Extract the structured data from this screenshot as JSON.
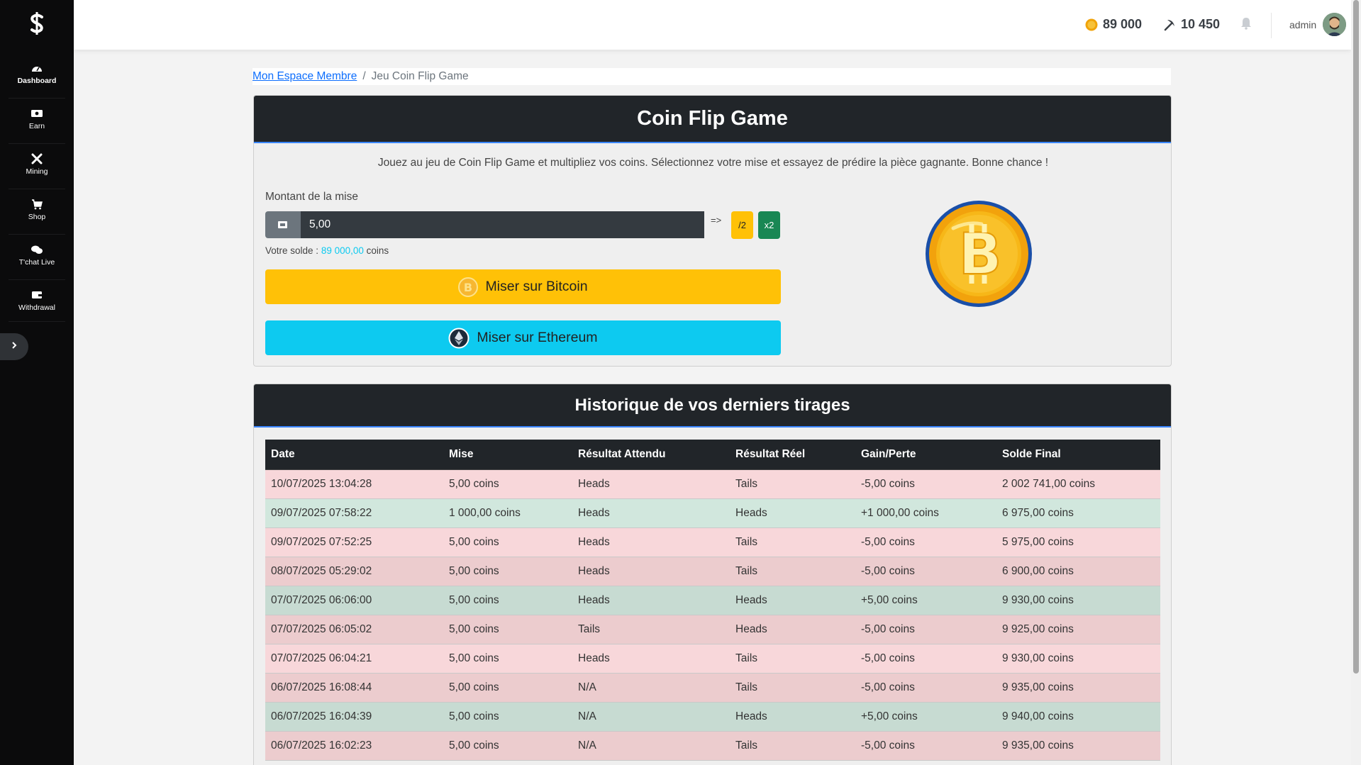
{
  "sidebar": {
    "items": [
      {
        "label": "Dashboard",
        "icon": "dashboard-icon"
      },
      {
        "label": "Earn",
        "icon": "money-icon"
      },
      {
        "label": "Mining",
        "icon": "tools-icon"
      },
      {
        "label": "Shop",
        "icon": "cart-icon"
      },
      {
        "label": "T'chat Live",
        "icon": "chat-icon"
      },
      {
        "label": "Withdrawal",
        "icon": "wallet-icon"
      }
    ]
  },
  "topbar": {
    "coins": "89 000",
    "mining": "10 450",
    "user": "admin"
  },
  "breadcrumb": {
    "home": "Mon Espace Membre",
    "separator": "/",
    "current": "Jeu Coin Flip Game"
  },
  "game": {
    "title": "Coin Flip Game",
    "intro": "Jouez au jeu de Coin Flip Game et multipliez vos coins. Sélectionnez votre mise et essayez de prédire la pièce gagnante. Bonne chance !",
    "bet_label": "Montant de la mise",
    "bet_value": "5,00",
    "arrow": "=>",
    "half_label": "/2",
    "double_label": "x2",
    "balance_prefix": "Votre solde :",
    "balance_amount": "89 000,00",
    "balance_suffix": "coins",
    "btc_button": "Miser sur Bitcoin",
    "eth_button": "Miser sur Ethereum"
  },
  "history": {
    "title": "Historique de vos derniers tirages",
    "columns": [
      "Date",
      "Mise",
      "Résultat Attendu",
      "Résultat Réel",
      "Gain/Perte",
      "Solde Final"
    ],
    "rows": [
      [
        "10/07/2025 13:04:28",
        "5,00 coins",
        "Heads",
        "Tails",
        "-5,00 coins",
        "2 002 741,00 coins",
        "loss"
      ],
      [
        "09/07/2025 07:58:22",
        "1 000,00 coins",
        "Heads",
        "Heads",
        "+1 000,00 coins",
        "6 975,00 coins",
        "win"
      ],
      [
        "09/07/2025 07:52:25",
        "5,00 coins",
        "Heads",
        "Tails",
        "-5,00 coins",
        "5 975,00 coins",
        "loss"
      ],
      [
        "08/07/2025 05:29:02",
        "5,00 coins",
        "Heads",
        "Tails",
        "-5,00 coins",
        "6 900,00 coins",
        "loss"
      ],
      [
        "07/07/2025 06:06:00",
        "5,00 coins",
        "Heads",
        "Heads",
        "+5,00 coins",
        "9 930,00 coins",
        "win"
      ],
      [
        "07/07/2025 06:05:02",
        "5,00 coins",
        "Tails",
        "Heads",
        "-5,00 coins",
        "9 925,00 coins",
        "loss"
      ],
      [
        "07/07/2025 06:04:21",
        "5,00 coins",
        "Heads",
        "Tails",
        "-5,00 coins",
        "9 930,00 coins",
        "loss"
      ],
      [
        "06/07/2025 16:08:44",
        "5,00 coins",
        "N/A",
        "Tails",
        "-5,00 coins",
        "9 935,00 coins",
        "loss"
      ],
      [
        "06/07/2025 16:04:39",
        "5,00 coins",
        "N/A",
        "Heads",
        "+5,00 coins",
        "9 940,00 coins",
        "win"
      ],
      [
        "06/07/2025 16:02:23",
        "5,00 coins",
        "N/A",
        "Tails",
        "-5,00 coins",
        "9 935,00 coins",
        "loss"
      ]
    ]
  },
  "colors": {
    "sidebar_bg": "#0b0b0c",
    "header_bg": "#212529",
    "warning": "#ffc107",
    "info": "#0dcaf0",
    "success": "#198754",
    "loss_row": "#f8d7da",
    "win_row": "#d1e7dd"
  }
}
